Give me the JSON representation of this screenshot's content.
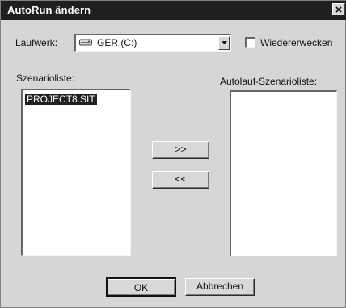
{
  "window": {
    "title": "AutoRun ändern",
    "close_symbol": "×"
  },
  "drive": {
    "label": "Laufwerk:",
    "selected_value": "GER (C:)",
    "icon": "drive-icon"
  },
  "wake": {
    "label": "Wiedererwecken",
    "checked": false
  },
  "scenario_list": {
    "label": "Szenarioliste:",
    "items": [
      "PROJECT8.SIT"
    ]
  },
  "autorun_list": {
    "label": "Autolauf-Szenarioliste:",
    "items": []
  },
  "actions": {
    "add": ">>",
    "remove": "<<"
  },
  "footer": {
    "ok": "OK",
    "cancel": "Abbrechen"
  }
}
